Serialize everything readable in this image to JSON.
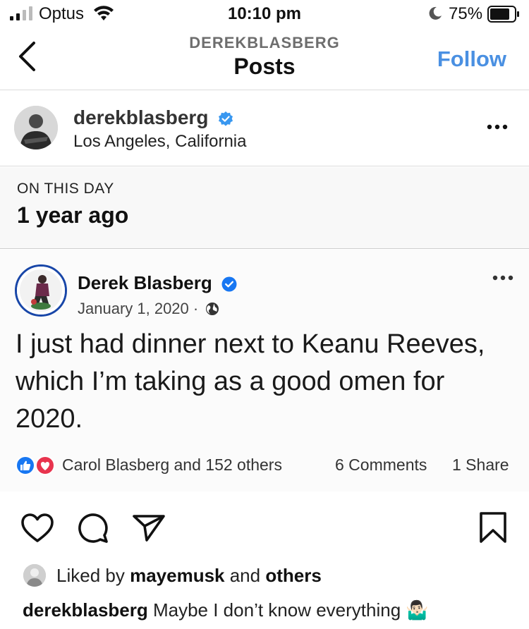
{
  "status_bar": {
    "carrier": "Optus",
    "time": "10:10 pm",
    "battery": "75%"
  },
  "header": {
    "subtitle": "DEREKBLASBERG",
    "title": "Posts",
    "follow_label": "Follow"
  },
  "profile": {
    "username": "derekblasberg",
    "location": "Los Angeles, California"
  },
  "on_this_day": {
    "label": "ON THIS DAY",
    "ago": "1 year ago"
  },
  "fb_post": {
    "author": "Derek Blasberg",
    "date": "January 1, 2020 ·",
    "text": "I just had dinner next to Keanu Reeves, which I’m taking as a good omen for 2020.",
    "reactions_text": "Carol Blasberg and 152 others",
    "comments_text": "6 Comments",
    "shares_text": "1 Share"
  },
  "likes": {
    "prefix": "Liked by ",
    "user": "mayemusk",
    "middle": " and ",
    "others": "others"
  },
  "caption": {
    "user": "derekblasberg",
    "text": " Maybe I don’t know everything 🤷🏻‍♂️"
  },
  "colors": {
    "follow_blue": "#4a90e2",
    "verified_blue": "#3897f0",
    "fb_verified": "#1877f2",
    "like_blue": "#1877f2",
    "love_red": "#e8344e"
  }
}
